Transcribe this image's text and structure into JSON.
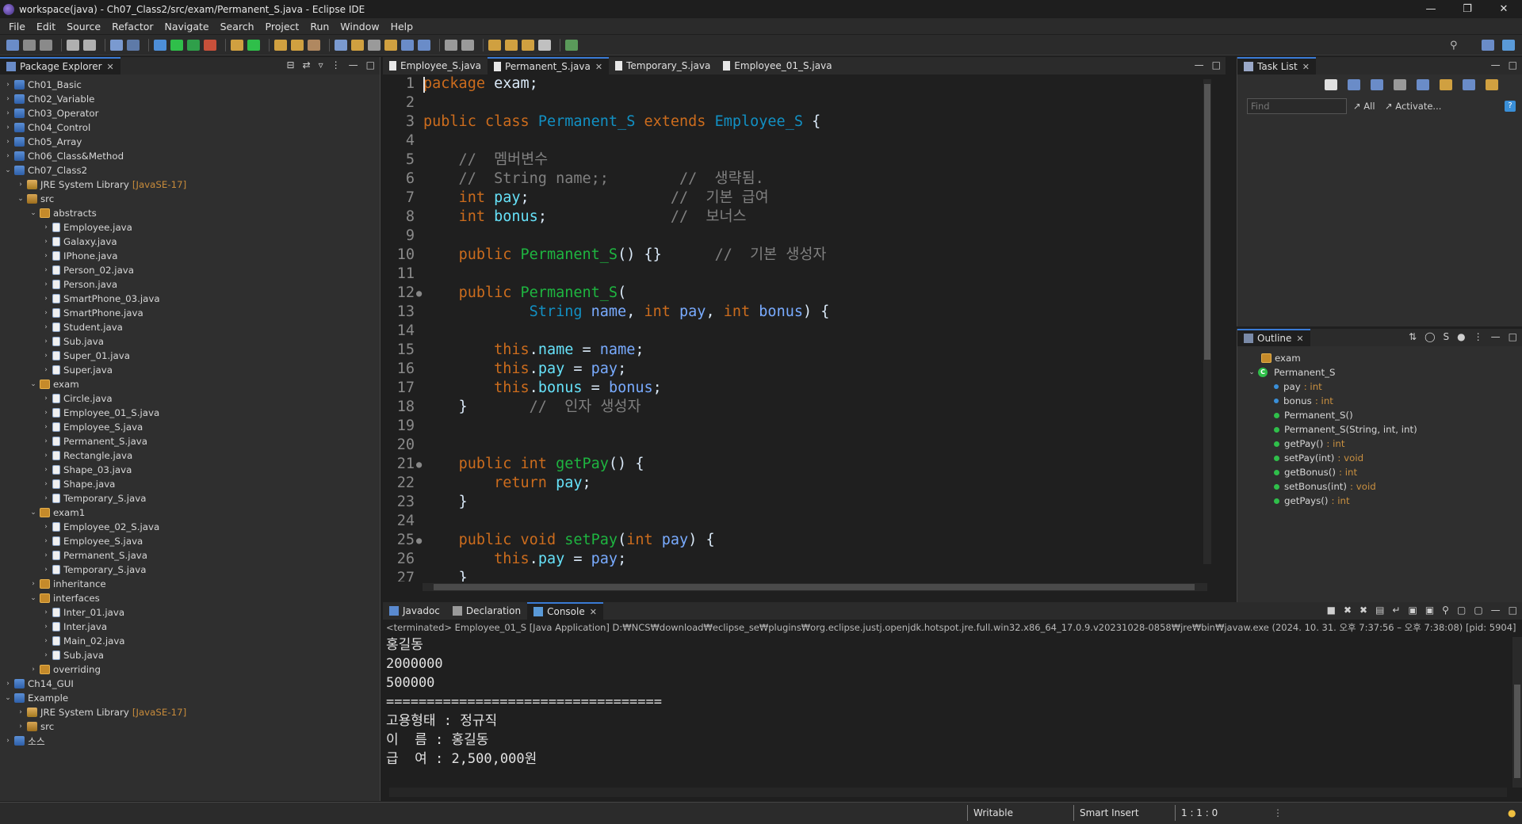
{
  "window": {
    "title": "workspace(java) - Ch07_Class2/src/exam/Permanent_S.java - Eclipse IDE"
  },
  "menu": [
    "File",
    "Edit",
    "Source",
    "Refactor",
    "Navigate",
    "Search",
    "Project",
    "Run",
    "Window",
    "Help"
  ],
  "package_explorer": {
    "title": "Package Explorer",
    "rows": [
      {
        "label": "Ch01_Basic",
        "indent": 0,
        "arrow": "›",
        "icon": "project"
      },
      {
        "label": "Ch02_Variable",
        "indent": 0,
        "arrow": "›",
        "icon": "project"
      },
      {
        "label": "Ch03_Operator",
        "indent": 0,
        "arrow": "›",
        "icon": "project"
      },
      {
        "label": "Ch04_Control",
        "indent": 0,
        "arrow": "›",
        "icon": "project"
      },
      {
        "label": "Ch05_Array",
        "indent": 0,
        "arrow": "›",
        "icon": "project"
      },
      {
        "label": "Ch06_Class&Method",
        "indent": 0,
        "arrow": "›",
        "icon": "project"
      },
      {
        "label": "Ch07_Class2",
        "indent": 0,
        "arrow": "⌄",
        "icon": "project"
      },
      {
        "label": "JRE System Library",
        "tag": "[JavaSE-17]",
        "indent": 1,
        "arrow": "›",
        "icon": "jre"
      },
      {
        "label": "src",
        "indent": 1,
        "arrow": "⌄",
        "icon": "src"
      },
      {
        "label": "abstracts",
        "indent": 2,
        "arrow": "⌄",
        "icon": "pkg"
      },
      {
        "label": "Employee.java",
        "indent": 3,
        "arrow": "›",
        "icon": "java"
      },
      {
        "label": "Galaxy.java",
        "indent": 3,
        "arrow": "›",
        "icon": "java"
      },
      {
        "label": "IPhone.java",
        "indent": 3,
        "arrow": "›",
        "icon": "java"
      },
      {
        "label": "Person_02.java",
        "indent": 3,
        "arrow": "›",
        "icon": "java"
      },
      {
        "label": "Person.java",
        "indent": 3,
        "arrow": "›",
        "icon": "java"
      },
      {
        "label": "SmartPhone_03.java",
        "indent": 3,
        "arrow": "›",
        "icon": "java"
      },
      {
        "label": "SmartPhone.java",
        "indent": 3,
        "arrow": "›",
        "icon": "java"
      },
      {
        "label": "Student.java",
        "indent": 3,
        "arrow": "›",
        "icon": "java"
      },
      {
        "label": "Sub.java",
        "indent": 3,
        "arrow": "›",
        "icon": "java"
      },
      {
        "label": "Super_01.java",
        "indent": 3,
        "arrow": "›",
        "icon": "java"
      },
      {
        "label": "Super.java",
        "indent": 3,
        "arrow": "›",
        "icon": "java"
      },
      {
        "label": "exam",
        "indent": 2,
        "arrow": "⌄",
        "icon": "pkg"
      },
      {
        "label": "Circle.java",
        "indent": 3,
        "arrow": "›",
        "icon": "java"
      },
      {
        "label": "Employee_01_S.java",
        "indent": 3,
        "arrow": "›",
        "icon": "java"
      },
      {
        "label": "Employee_S.java",
        "indent": 3,
        "arrow": "›",
        "icon": "java"
      },
      {
        "label": "Permanent_S.java",
        "indent": 3,
        "arrow": "›",
        "icon": "java"
      },
      {
        "label": "Rectangle.java",
        "indent": 3,
        "arrow": "›",
        "icon": "java"
      },
      {
        "label": "Shape_03.java",
        "indent": 3,
        "arrow": "›",
        "icon": "java"
      },
      {
        "label": "Shape.java",
        "indent": 3,
        "arrow": "›",
        "icon": "java"
      },
      {
        "label": "Temporary_S.java",
        "indent": 3,
        "arrow": "›",
        "icon": "java"
      },
      {
        "label": "exam1",
        "indent": 2,
        "arrow": "⌄",
        "icon": "pkg"
      },
      {
        "label": "Employee_02_S.java",
        "indent": 3,
        "arrow": "›",
        "icon": "java"
      },
      {
        "label": "Employee_S.java",
        "indent": 3,
        "arrow": "›",
        "icon": "java"
      },
      {
        "label": "Permanent_S.java",
        "indent": 3,
        "arrow": "›",
        "icon": "java"
      },
      {
        "label": "Temporary_S.java",
        "indent": 3,
        "arrow": "›",
        "icon": "java"
      },
      {
        "label": "inheritance",
        "indent": 2,
        "arrow": "›",
        "icon": "pkg"
      },
      {
        "label": "interfaces",
        "indent": 2,
        "arrow": "⌄",
        "icon": "pkg"
      },
      {
        "label": "Inter_01.java",
        "indent": 3,
        "arrow": "›",
        "icon": "java"
      },
      {
        "label": "Inter.java",
        "indent": 3,
        "arrow": "›",
        "icon": "java"
      },
      {
        "label": "Main_02.java",
        "indent": 3,
        "arrow": "›",
        "icon": "java"
      },
      {
        "label": "Sub.java",
        "indent": 3,
        "arrow": "›",
        "icon": "java"
      },
      {
        "label": "overriding",
        "indent": 2,
        "arrow": "›",
        "icon": "pkg"
      },
      {
        "label": "Ch14_GUI",
        "indent": 0,
        "arrow": "›",
        "icon": "project"
      },
      {
        "label": "Example",
        "indent": 0,
        "arrow": "⌄",
        "icon": "project"
      },
      {
        "label": "JRE System Library",
        "tag": "[JavaSE-17]",
        "indent": 1,
        "arrow": "›",
        "icon": "jre"
      },
      {
        "label": "src",
        "indent": 1,
        "arrow": "›",
        "icon": "src"
      },
      {
        "label": "소스",
        "indent": 0,
        "arrow": "›",
        "icon": "project"
      }
    ]
  },
  "editor": {
    "tabs": [
      {
        "label": "Employee_S.java",
        "active": false
      },
      {
        "label": "Permanent_S.java",
        "active": true
      },
      {
        "label": "Temporary_S.java",
        "active": false
      },
      {
        "label": "Employee_01_S.java",
        "active": false
      }
    ],
    "lines": [
      {
        "n": "1",
        "tokens": [
          [
            "kw",
            "package"
          ],
          [
            "pl",
            " exam;"
          ]
        ]
      },
      {
        "n": "2",
        "tokens": []
      },
      {
        "n": "3",
        "tokens": [
          [
            "kw",
            "public"
          ],
          [
            "pl",
            " "
          ],
          [
            "kw",
            "class"
          ],
          [
            "pl",
            " "
          ],
          [
            "ty",
            "Permanent_S"
          ],
          [
            "pl",
            " "
          ],
          [
            "kw",
            "extends"
          ],
          [
            "pl",
            " "
          ],
          [
            "ty",
            "Employee_S"
          ],
          [
            "pl",
            " {"
          ]
        ]
      },
      {
        "n": "4",
        "tokens": []
      },
      {
        "n": "5",
        "tokens": [
          [
            "cm",
            "    //  멤버변수"
          ]
        ]
      },
      {
        "n": "6",
        "tokens": [
          [
            "cm",
            "    //  String name;;        //  생략됨."
          ]
        ]
      },
      {
        "n": "7",
        "tokens": [
          [
            "pl",
            "    "
          ],
          [
            "kw",
            "int"
          ],
          [
            "pl",
            " "
          ],
          [
            "fld",
            "pay"
          ],
          [
            "pl",
            ";"
          ],
          [
            "cm",
            "                //  기본 급여"
          ]
        ]
      },
      {
        "n": "8",
        "tokens": [
          [
            "pl",
            "    "
          ],
          [
            "kw",
            "int"
          ],
          [
            "pl",
            " "
          ],
          [
            "fld",
            "bonus"
          ],
          [
            "pl",
            ";"
          ],
          [
            "cm",
            "              //  보너스"
          ]
        ]
      },
      {
        "n": "9",
        "tokens": []
      },
      {
        "n": "10",
        "tokens": [
          [
            "pl",
            "    "
          ],
          [
            "kw",
            "public"
          ],
          [
            "pl",
            " "
          ],
          [
            "fn",
            "Permanent_S"
          ],
          [
            "pl",
            "() {}"
          ],
          [
            "cm",
            "      //  기본 생성자"
          ]
        ]
      },
      {
        "n": "11",
        "tokens": []
      },
      {
        "n": "12",
        "marker": "●",
        "tokens": [
          [
            "pl",
            "    "
          ],
          [
            "kw",
            "public"
          ],
          [
            "pl",
            " "
          ],
          [
            "fn",
            "Permanent_S"
          ],
          [
            "pl",
            "("
          ]
        ]
      },
      {
        "n": "13",
        "tokens": [
          [
            "pl",
            "            "
          ],
          [
            "ty",
            "String"
          ],
          [
            "pl",
            " "
          ],
          [
            "par",
            "name"
          ],
          [
            "pl",
            ", "
          ],
          [
            "kw",
            "int"
          ],
          [
            "pl",
            " "
          ],
          [
            "par",
            "pay"
          ],
          [
            "pl",
            ", "
          ],
          [
            "kw",
            "int"
          ],
          [
            "pl",
            " "
          ],
          [
            "par",
            "bonus"
          ],
          [
            "pl",
            ") {"
          ]
        ]
      },
      {
        "n": "14",
        "tokens": []
      },
      {
        "n": "15",
        "tokens": [
          [
            "pl",
            "        "
          ],
          [
            "kw",
            "this"
          ],
          [
            "pl",
            "."
          ],
          [
            "fld",
            "name"
          ],
          [
            "pl",
            " = "
          ],
          [
            "par",
            "name"
          ],
          [
            "pl",
            ";"
          ]
        ]
      },
      {
        "n": "16",
        "tokens": [
          [
            "pl",
            "        "
          ],
          [
            "kw",
            "this"
          ],
          [
            "pl",
            "."
          ],
          [
            "fld",
            "pay"
          ],
          [
            "pl",
            " = "
          ],
          [
            "par",
            "pay"
          ],
          [
            "pl",
            ";"
          ]
        ]
      },
      {
        "n": "17",
        "tokens": [
          [
            "pl",
            "        "
          ],
          [
            "kw",
            "this"
          ],
          [
            "pl",
            "."
          ],
          [
            "fld",
            "bonus"
          ],
          [
            "pl",
            " = "
          ],
          [
            "par",
            "bonus"
          ],
          [
            "pl",
            ";"
          ]
        ]
      },
      {
        "n": "18",
        "tokens": [
          [
            "pl",
            "    }"
          ],
          [
            "cm",
            "       //  인자 생성자"
          ]
        ]
      },
      {
        "n": "19",
        "tokens": []
      },
      {
        "n": "20",
        "tokens": []
      },
      {
        "n": "21",
        "marker": "●",
        "tokens": [
          [
            "pl",
            "    "
          ],
          [
            "kw",
            "public"
          ],
          [
            "pl",
            " "
          ],
          [
            "kw",
            "int"
          ],
          [
            "pl",
            " "
          ],
          [
            "fn",
            "getPay"
          ],
          [
            "pl",
            "() {"
          ]
        ]
      },
      {
        "n": "22",
        "tokens": [
          [
            "pl",
            "        "
          ],
          [
            "kw",
            "return"
          ],
          [
            "pl",
            " "
          ],
          [
            "fld",
            "pay"
          ],
          [
            "pl",
            ";"
          ]
        ]
      },
      {
        "n": "23",
        "tokens": [
          [
            "pl",
            "    }"
          ]
        ]
      },
      {
        "n": "24",
        "tokens": []
      },
      {
        "n": "25",
        "marker": "●",
        "tokens": [
          [
            "pl",
            "    "
          ],
          [
            "kw",
            "public"
          ],
          [
            "pl",
            " "
          ],
          [
            "kw",
            "void"
          ],
          [
            "pl",
            " "
          ],
          [
            "fn",
            "setPay"
          ],
          [
            "pl",
            "("
          ],
          [
            "kw",
            "int"
          ],
          [
            "pl",
            " "
          ],
          [
            "par",
            "pay"
          ],
          [
            "pl",
            ") {"
          ]
        ]
      },
      {
        "n": "26",
        "tokens": [
          [
            "pl",
            "        "
          ],
          [
            "kw",
            "this"
          ],
          [
            "pl",
            "."
          ],
          [
            "fld",
            "pay"
          ],
          [
            "pl",
            " = "
          ],
          [
            "par",
            "pay"
          ],
          [
            "pl",
            ";"
          ]
        ]
      },
      {
        "n": "27",
        "tokens": [
          [
            "pl",
            "    }"
          ]
        ]
      }
    ]
  },
  "task_list": {
    "title": "Task List",
    "find_placeholder": "Find",
    "filter_all": "All",
    "filter_activate": "Activate..."
  },
  "outline": {
    "title": "Outline",
    "items": [
      {
        "label": "exam",
        "type": "",
        "kind": "pkg",
        "indent": 0
      },
      {
        "label": "Permanent_S",
        "type": "",
        "kind": "class",
        "indent": 0
      },
      {
        "label": "pay",
        "type": " : int",
        "kind": "field",
        "indent": 1
      },
      {
        "label": "bonus",
        "type": " : int",
        "kind": "field",
        "indent": 1
      },
      {
        "label": "Permanent_S()",
        "type": "",
        "kind": "ctor",
        "indent": 1
      },
      {
        "label": "Permanent_S(String, int, int)",
        "type": "",
        "kind": "ctor",
        "indent": 1
      },
      {
        "label": "getPay()",
        "type": " : int",
        "kind": "method",
        "indent": 1
      },
      {
        "label": "setPay(int)",
        "type": " : void",
        "kind": "method",
        "indent": 1
      },
      {
        "label": "getBonus()",
        "type": " : int",
        "kind": "method",
        "indent": 1
      },
      {
        "label": "setBonus(int)",
        "type": " : void",
        "kind": "method",
        "indent": 1
      },
      {
        "label": "getPays()",
        "type": " : int",
        "kind": "override",
        "indent": 1
      }
    ]
  },
  "bottom": {
    "tabs": [
      {
        "label": "Javadoc",
        "active": false
      },
      {
        "label": "Declaration",
        "active": false
      },
      {
        "label": "Console",
        "active": true
      }
    ],
    "status": "<terminated> Employee_01_S [Java Application] D:₩NCS₩download₩eclipse_se₩plugins₩org.eclipse.justj.openjdk.hotspot.jre.full.win32.x86_64_17.0.9.v20231028-0858₩jre₩bin₩javaw.exe  (2024. 10. 31. 오후 7:37:56 – 오후 7:38:08) [pid: 5904]",
    "output": [
      "홍길동",
      "2000000",
      "500000",
      "==================================",
      "고용형태 : 정규직",
      "이  름 : 홍길동",
      "급  여 : 2,500,000원"
    ]
  },
  "statusbar": {
    "writable": "Writable",
    "insert_mode": "Smart Insert",
    "position": "1 : 1 : 0"
  },
  "colors": {
    "keyword": "#cc6c1d",
    "type": "#1290c3",
    "method": "#1eb540",
    "field": "#66e1f8",
    "comment": "#808080",
    "active_tab": "#3a7bd5"
  }
}
